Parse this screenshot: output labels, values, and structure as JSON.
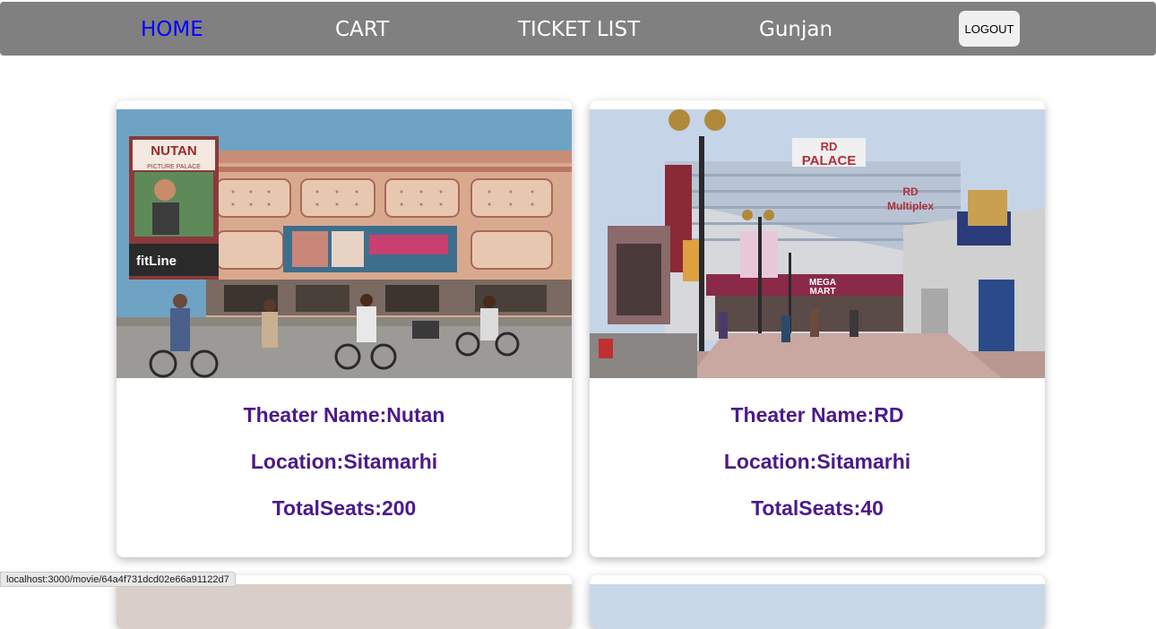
{
  "nav": {
    "items": [
      {
        "label": "HOME",
        "active": true
      },
      {
        "label": "CART"
      },
      {
        "label": "TICKET LIST"
      },
      {
        "label": "Gunjan"
      }
    ],
    "logout_label": "LOGOUT"
  },
  "theaters": [
    {
      "name": "Theater Name:Nutan",
      "location": "Location:Sitamarhi",
      "seats": "TotalSeats:200",
      "image": {
        "signage": "NUTAN",
        "subsign": "PICTURE PALACE",
        "ad_text": "fitLine"
      }
    },
    {
      "name": "Theater Name:RD",
      "location": "Location:Sitamarhi",
      "seats": "TotalSeats:40",
      "image": {
        "signage": "RD",
        "signage_line2": "PALACE",
        "side_sign": "RD",
        "side_sign_line2": "Multiplex",
        "mart": "MEGA",
        "mart_line2": "MART"
      }
    }
  ],
  "status_url": "localhost:3000/movie/64a4f731dcd02e66a91122d7"
}
